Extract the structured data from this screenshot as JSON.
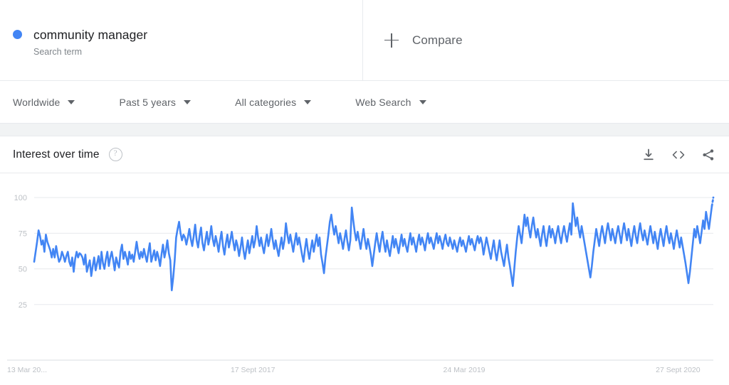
{
  "term": {
    "name": "community manager",
    "subtitle": "Search term",
    "dot_color": "#4285f4"
  },
  "compare": {
    "label": "Compare",
    "icon": "plus-icon"
  },
  "filters": [
    {
      "label": "Worldwide",
      "icon": "chevron-down-icon"
    },
    {
      "label": "Past 5 years",
      "icon": "chevron-down-icon"
    },
    {
      "label": "All categories",
      "icon": "chevron-down-icon"
    },
    {
      "label": "Web Search",
      "icon": "chevron-down-icon"
    }
  ],
  "card": {
    "title": "Interest over time",
    "help_icon": "help-circle-icon",
    "actions": [
      {
        "name": "download-icon",
        "title": "Download"
      },
      {
        "name": "embed-code-icon",
        "title": "Embed"
      },
      {
        "name": "share-icon",
        "title": "Share"
      }
    ]
  },
  "chart_data": {
    "type": "line",
    "title": "Interest over time",
    "xlabel": "",
    "ylabel": "",
    "ylim": [
      0,
      110
    ],
    "yticks": [
      25,
      50,
      75,
      100
    ],
    "ytick_labels": [
      "25",
      "50",
      "75",
      "100"
    ],
    "xtick_labels": [
      "13 Mar 20...",
      "17 Sept 2017",
      "24 Mar 2019",
      "27 Sept 2020"
    ],
    "xtick_positions": [
      0,
      0.3165,
      0.6175,
      0.9185
    ],
    "grid": true,
    "legend": false,
    "line_color": "#4285f4",
    "partial_segment_dotted": true,
    "series": [
      {
        "name": "community manager",
        "values": [
          55,
          62,
          69,
          77,
          73,
          67,
          70,
          62,
          74,
          69,
          66,
          63,
          58,
          64,
          58,
          66,
          60,
          55,
          57,
          62,
          59,
          55,
          59,
          62,
          55,
          52,
          58,
          48,
          57,
          62,
          58,
          61,
          60,
          58,
          53,
          60,
          48,
          52,
          56,
          45,
          52,
          58,
          49,
          54,
          59,
          50,
          62,
          54,
          50,
          57,
          62,
          52,
          58,
          62,
          56,
          49,
          58,
          54,
          51,
          62,
          67,
          57,
          62,
          58,
          53,
          62,
          57,
          60,
          55,
          62,
          69,
          62,
          57,
          62,
          58,
          64,
          59,
          55,
          62,
          68,
          55,
          59,
          63,
          56,
          62,
          58,
          52,
          60,
          67,
          58,
          63,
          70,
          61,
          56,
          35,
          44,
          56,
          72,
          78,
          83,
          75,
          70,
          74,
          72,
          67,
          72,
          78,
          71,
          66,
          73,
          81,
          70,
          65,
          73,
          79,
          68,
          63,
          70,
          76,
          67,
          72,
          80,
          71,
          66,
          73,
          68,
          62,
          70,
          76,
          66,
          60,
          68,
          74,
          65,
          70,
          76,
          69,
          63,
          70,
          66,
          59,
          65,
          72,
          63,
          57,
          64,
          70,
          61,
          67,
          73,
          65,
          70,
          80,
          72,
          66,
          72,
          66,
          61,
          68,
          74,
          66,
          71,
          78,
          70,
          64,
          70,
          64,
          59,
          66,
          72,
          64,
          70,
          82,
          74,
          68,
          74,
          68,
          62,
          69,
          75,
          67,
          72,
          66,
          60,
          55,
          64,
          71,
          63,
          57,
          64,
          70,
          62,
          68,
          74,
          66,
          72,
          60,
          54,
          47,
          58,
          66,
          74,
          83,
          88,
          80,
          74,
          80,
          74,
          68,
          75,
          70,
          64,
          71,
          77,
          69,
          63,
          70,
          93,
          84,
          76,
          70,
          76,
          70,
          64,
          71,
          78,
          70,
          64,
          71,
          66,
          60,
          52,
          60,
          68,
          75,
          68,
          62,
          70,
          76,
          68,
          62,
          70,
          64,
          59,
          66,
          73,
          65,
          71,
          66,
          61,
          68,
          74,
          66,
          71,
          66,
          62,
          69,
          75,
          67,
          72,
          67,
          62,
          69,
          74,
          67,
          72,
          68,
          63,
          70,
          75,
          68,
          72,
          68,
          64,
          70,
          75,
          68,
          73,
          69,
          64,
          70,
          74,
          68,
          66,
          72,
          68,
          64,
          70,
          66,
          62,
          68,
          72,
          66,
          70,
          66,
          62,
          68,
          73,
          67,
          71,
          67,
          63,
          69,
          73,
          68,
          72,
          68,
          60,
          66,
          72,
          67,
          62,
          57,
          64,
          70,
          62,
          56,
          63,
          70,
          62,
          57,
          52,
          60,
          67,
          58,
          52,
          45,
          38,
          50,
          62,
          72,
          80,
          74,
          68,
          78,
          88,
          80,
          86,
          78,
          72,
          80,
          86,
          78,
          72,
          78,
          72,
          66,
          74,
          80,
          72,
          66,
          74,
          80,
          72,
          78,
          74,
          68,
          75,
          80,
          73,
          68,
          75,
          80,
          74,
          69,
          76,
          82,
          74,
          96,
          88,
          80,
          86,
          78,
          72,
          80,
          74,
          68,
          62,
          56,
          50,
          44,
          52,
          62,
          70,
          78,
          72,
          66,
          74,
          80,
          74,
          68,
          76,
          82,
          76,
          70,
          78,
          73,
          68,
          75,
          80,
          74,
          68,
          76,
          82,
          76,
          70,
          78,
          72,
          66,
          74,
          80,
          73,
          68,
          76,
          82,
          75,
          70,
          77,
          72,
          67,
          74,
          80,
          74,
          68,
          76,
          70,
          64,
          72,
          78,
          72,
          66,
          74,
          80,
          73,
          68,
          75,
          70,
          64,
          71,
          77,
          71,
          65,
          72,
          66,
          60,
          54,
          47,
          40,
          48,
          58,
          68,
          78,
          72,
          80,
          74,
          68,
          76,
          84,
          78,
          90,
          84,
          78,
          86,
          94,
          100
        ]
      }
    ]
  }
}
